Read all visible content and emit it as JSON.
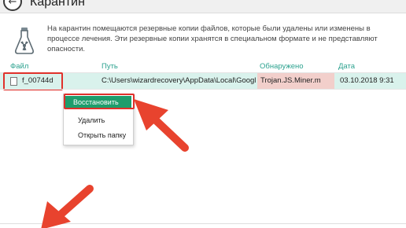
{
  "window": {
    "title": "Карантин",
    "back_glyph": "←"
  },
  "info": {
    "icon": "quarantine-flask-icon",
    "text": "На карантин помещаются резервные копии файлов, которые были удалены или изменены в процессе лечения. Эти резервные копии хранятся в специальном формате и не представляют опасности."
  },
  "table": {
    "columns": {
      "file": "Файл",
      "path": "Путь",
      "detected": "Обнаружено",
      "date": "Дата"
    },
    "rows": [
      {
        "file": "f_00744d",
        "path": "C:\\Users\\wizardrecovery\\AppData\\Local\\Google\\Ch...",
        "detected": "Trojan.JS.Miner.m",
        "date": "03.10.2018 9:31"
      }
    ]
  },
  "context_menu": {
    "restore": "Восстановить",
    "delete": "Удалить",
    "open_folder": "Открыть папку"
  },
  "colors": {
    "accent": "#2ca28f",
    "selected_row": "#d9f2ec",
    "threat_cell": "#f2cfcb",
    "restore_button": "#1e9d6c",
    "highlight": "#e0312b",
    "arrow": "#e8432e"
  }
}
